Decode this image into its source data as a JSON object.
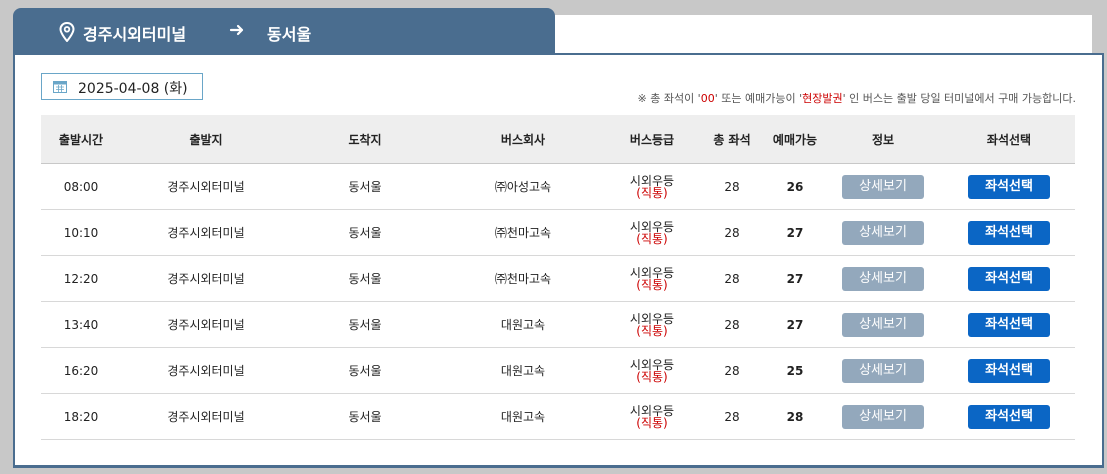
{
  "route": {
    "from": "경주시외터미널",
    "to": "동서울"
  },
  "date_label": "2025-04-08 (화)",
  "notice": {
    "prefix": "※ 총 좌석이 '",
    "zero": "00",
    "middle": "' 또는 예매가능이 '",
    "onsite": "현장발권",
    "suffix": "' 인 버스는 출발 당일 터미널에서 구매 가능합니다."
  },
  "columns": [
    "출발시간",
    "출발지",
    "도착지",
    "버스회사",
    "버스등급",
    "총 좌석",
    "예매가능",
    "정보",
    "좌석선택"
  ],
  "buttons": {
    "detail": "상세보기",
    "seat": "좌석선택"
  },
  "rows": [
    {
      "time": "08:00",
      "origin": "경주시외터미널",
      "dest": "동서울",
      "company": "㈜아성고속",
      "grade": "시외우등",
      "grade_sub": "(직통)",
      "total": "28",
      "available": "26"
    },
    {
      "time": "10:10",
      "origin": "경주시외터미널",
      "dest": "동서울",
      "company": "㈜천마고속",
      "grade": "시외우등",
      "grade_sub": "(직통)",
      "total": "28",
      "available": "27"
    },
    {
      "time": "12:20",
      "origin": "경주시외터미널",
      "dest": "동서울",
      "company": "㈜천마고속",
      "grade": "시외우등",
      "grade_sub": "(직통)",
      "total": "28",
      "available": "27"
    },
    {
      "time": "13:40",
      "origin": "경주시외터미널",
      "dest": "동서울",
      "company": "대원고속",
      "grade": "시외우등",
      "grade_sub": "(직통)",
      "total": "28",
      "available": "27"
    },
    {
      "time": "16:20",
      "origin": "경주시외터미널",
      "dest": "동서울",
      "company": "대원고속",
      "grade": "시외우등",
      "grade_sub": "(직통)",
      "total": "28",
      "available": "25"
    },
    {
      "time": "18:20",
      "origin": "경주시외터미널",
      "dest": "동서울",
      "company": "대원고속",
      "grade": "시외우등",
      "grade_sub": "(직통)",
      "total": "28",
      "available": "28"
    }
  ],
  "colors": {
    "header": "#4a6d8f",
    "seat_button": "#0b66c5",
    "detail_button": "#93a8bc",
    "highlight": "#cc0000"
  },
  "icons": {
    "pin": "map-pin-icon",
    "arrow": "arrow-right-icon",
    "calendar": "calendar-icon"
  }
}
